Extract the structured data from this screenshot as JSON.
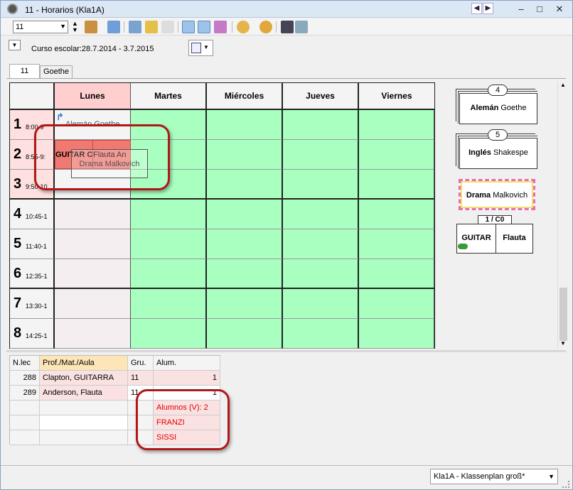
{
  "window": {
    "title": "11 -   Horarios  (Kla1A)",
    "controls": {
      "minimize": "–",
      "maximize": "□",
      "close": "✕"
    }
  },
  "toolbar": {
    "class_value": "11"
  },
  "school_year": "Curso escolar:28.7.2014 - 3.7.2015",
  "tabs": [
    {
      "label": "11"
    },
    {
      "label": "Goethe"
    }
  ],
  "days": [
    "Lunes",
    "Martes",
    "Miércoles",
    "Jueves",
    "Viernes"
  ],
  "periods": [
    {
      "num": "1",
      "time": "8:00-9"
    },
    {
      "num": "2",
      "time": "8:55-9:"
    },
    {
      "num": "3",
      "time": "9:50-10"
    },
    {
      "num": "4",
      "time": "10:45-1"
    },
    {
      "num": "5",
      "time": "11:40-1"
    },
    {
      "num": "6",
      "time": "12:35-1"
    },
    {
      "num": "7",
      "time": "13:30-1"
    },
    {
      "num": "8",
      "time": "14:25-1"
    }
  ],
  "grid_lessons": {
    "p1": "Alemán Goethe",
    "p2a": "GUITAR C",
    "p2b": "Flauta An",
    "p2_drag": "Drama Malkovich"
  },
  "side_cards": [
    {
      "count": "4",
      "subject": "Alemán",
      "teacher": "Goethe"
    },
    {
      "count": "5",
      "subject": "Inglés",
      "teacher": "Shakespe"
    },
    {
      "count": "",
      "subject": "Drama",
      "teacher": "Malkovich"
    }
  ],
  "coupling_card": {
    "label": "1 / C0",
    "left": "GUITAR",
    "right": "Flauta"
  },
  "lesson_table": {
    "headers": [
      "N.lec",
      "Prof./Mat./Aula",
      "Gru.",
      "Alum."
    ],
    "rows": [
      {
        "id": "288",
        "name": "Clapton, GUITARRA",
        "group": "11",
        "count": "1"
      },
      {
        "id": "289",
        "name": "Anderson, Flauta",
        "group": "11",
        "count": "1"
      }
    ],
    "students_header": "Alumnos (V): 2",
    "students": [
      "FRANZI",
      "SISSI"
    ]
  },
  "status": {
    "view_select": "Kla1A - Klassenplan groß*"
  },
  "colors": {
    "green": "#a8ffc0",
    "pink": "#ffcfcf",
    "red_cell": "#f07a72",
    "highlight": "#b01818"
  }
}
